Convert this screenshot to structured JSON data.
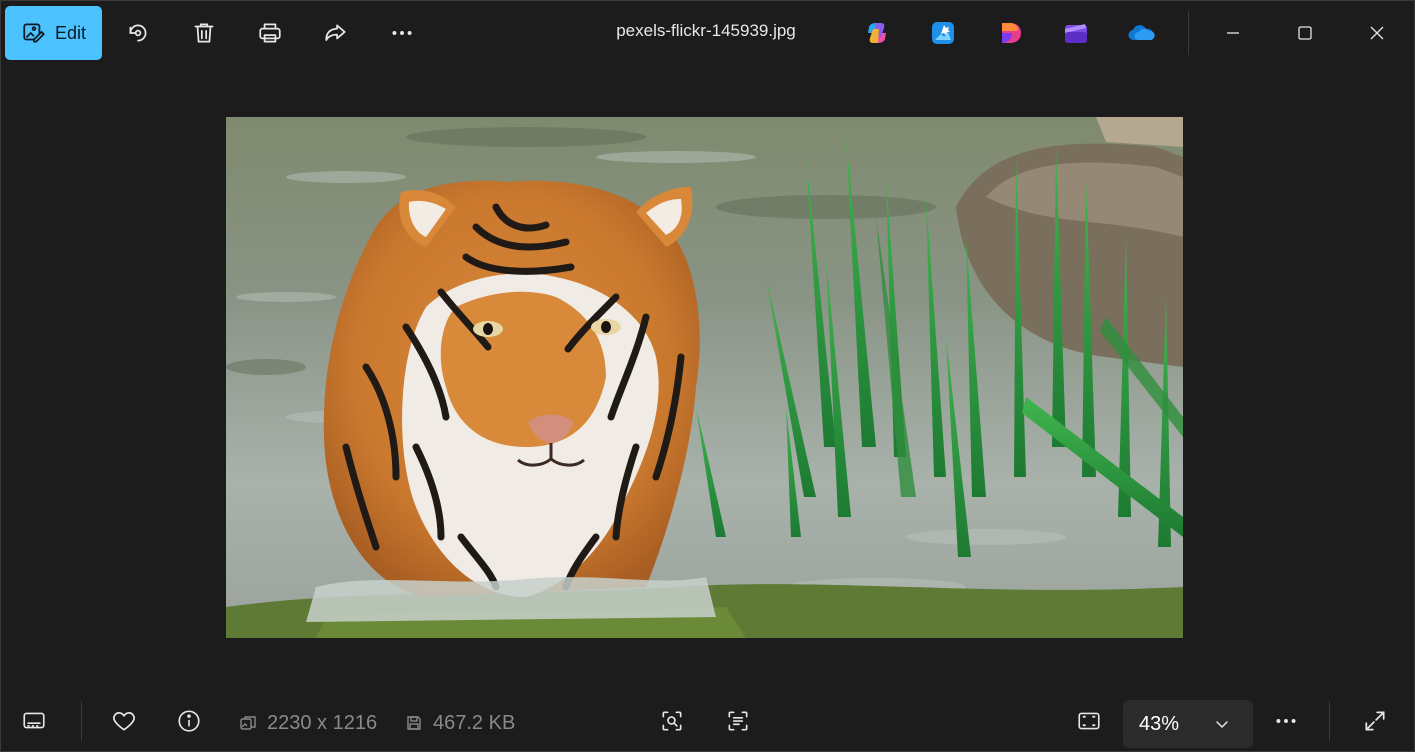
{
  "toolbar": {
    "edit_label": "Edit",
    "file_name": "pexels-flickr-145939.jpg"
  },
  "icons": {
    "edit": "edit-image-icon",
    "rotate": "rotate-icon",
    "delete": "trash-icon",
    "print": "print-icon",
    "share": "share-icon",
    "more": "more-icon",
    "copilot": "copilot-icon",
    "designer": "designer-icon",
    "clipchamp_like": "app-icon",
    "clipchamp": "clipchamp-icon",
    "onedrive": "onedrive-icon"
  },
  "status": {
    "dimensions": "2230 x 1216",
    "file_size": "467.2 KB",
    "zoom": "43%"
  },
  "colors": {
    "accent": "#4cc2ff",
    "background": "#1c1c1c",
    "muted_text": "#8a8a8a"
  }
}
